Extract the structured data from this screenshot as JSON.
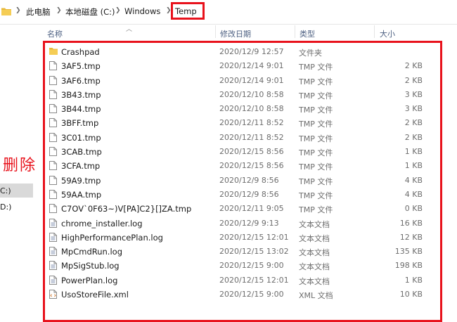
{
  "breadcrumb": {
    "items": [
      "此电脑",
      "本地磁盘 (C:)",
      "Windows",
      "Temp"
    ]
  },
  "columns": {
    "name": "名称",
    "date": "修改日期",
    "type": "类型",
    "size": "大小"
  },
  "nav": {
    "items": [
      {
        "label": "C:)",
        "selected": true
      },
      {
        "label": "D:)",
        "selected": false
      }
    ]
  },
  "annotation": {
    "text": "删除",
    "color": "#e8121c"
  },
  "files": [
    {
      "name": "Crashpad",
      "date": "2020/12/9 12:57",
      "type": "文件夹",
      "size": "",
      "icon": "folder-icon"
    },
    {
      "name": "3AF5.tmp",
      "date": "2020/12/14 9:01",
      "type": "TMP 文件",
      "size": "2 KB",
      "icon": "file-icon"
    },
    {
      "name": "3AF6.tmp",
      "date": "2020/12/14 9:01",
      "type": "TMP 文件",
      "size": "2 KB",
      "icon": "file-icon"
    },
    {
      "name": "3B43.tmp",
      "date": "2020/12/10 8:58",
      "type": "TMP 文件",
      "size": "3 KB",
      "icon": "file-icon"
    },
    {
      "name": "3B44.tmp",
      "date": "2020/12/10 8:58",
      "type": "TMP 文件",
      "size": "3 KB",
      "icon": "file-icon"
    },
    {
      "name": "3BFF.tmp",
      "date": "2020/12/11 8:52",
      "type": "TMP 文件",
      "size": "2 KB",
      "icon": "file-icon"
    },
    {
      "name": "3C01.tmp",
      "date": "2020/12/11 8:52",
      "type": "TMP 文件",
      "size": "2 KB",
      "icon": "file-icon"
    },
    {
      "name": "3CAB.tmp",
      "date": "2020/12/15 8:56",
      "type": "TMP 文件",
      "size": "1 KB",
      "icon": "file-icon"
    },
    {
      "name": "3CFA.tmp",
      "date": "2020/12/15 8:56",
      "type": "TMP 文件",
      "size": "1 KB",
      "icon": "file-icon"
    },
    {
      "name": "59A9.tmp",
      "date": "2020/12/9 8:56",
      "type": "TMP 文件",
      "size": "4 KB",
      "icon": "file-icon"
    },
    {
      "name": "59AA.tmp",
      "date": "2020/12/9 8:56",
      "type": "TMP 文件",
      "size": "4 KB",
      "icon": "file-icon"
    },
    {
      "name": "C7OV`0F63~)V[PA]C2}[]ZA.tmp",
      "date": "2020/12/11 9:05",
      "type": "TMP 文件",
      "size": "0 KB",
      "icon": "file-icon"
    },
    {
      "name": "chrome_installer.log",
      "date": "2020/12/9 9:13",
      "type": "文本文档",
      "size": "16 KB",
      "icon": "text-file-icon"
    },
    {
      "name": "HighPerformancePlan.log",
      "date": "2020/12/15 12:01",
      "type": "文本文档",
      "size": "12 KB",
      "icon": "text-file-icon"
    },
    {
      "name": "MpCmdRun.log",
      "date": "2020/12/15 13:02",
      "type": "文本文档",
      "size": "135 KB",
      "icon": "text-file-icon"
    },
    {
      "name": "MpSigStub.log",
      "date": "2020/12/15 9:00",
      "type": "文本文档",
      "size": "198 KB",
      "icon": "text-file-icon"
    },
    {
      "name": "PowerPlan.log",
      "date": "2020/12/15 12:01",
      "type": "文本文档",
      "size": "1 KB",
      "icon": "text-file-icon"
    },
    {
      "name": "UsoStoreFile.xml",
      "date": "2020/12/15 9:00",
      "type": "XML 文档",
      "size": "10 KB",
      "icon": "xml-file-icon"
    }
  ]
}
